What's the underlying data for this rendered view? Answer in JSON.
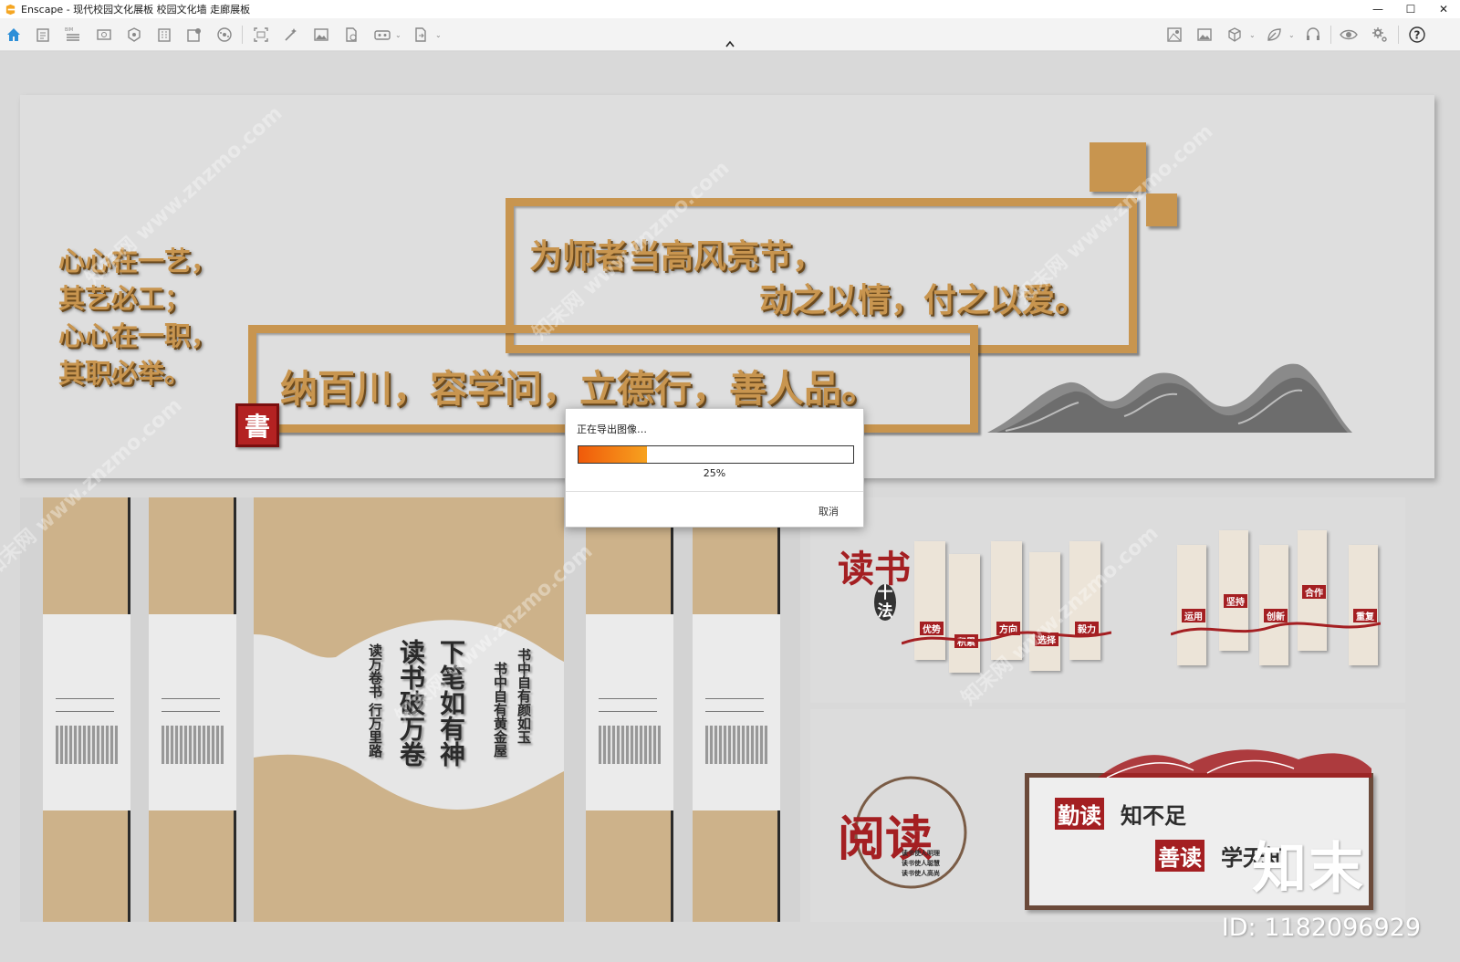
{
  "window": {
    "title": "Enscape - 现代校园文化展板 校园文化墙 走廊展板",
    "controls": {
      "minimize": "—",
      "maximize": "☐",
      "close": "✕"
    }
  },
  "toolbar": {
    "left_icons": [
      "home-icon",
      "project-icon",
      "bim-icon",
      "views-icon",
      "asset-icon",
      "building-icon",
      "material-icon",
      "atmosphere-icon",
      "screenshot-icon",
      "batch-icon",
      "image-icon",
      "document-icon",
      "vr-icon",
      "export-icon"
    ],
    "right_icons": [
      "visual-settings-icon",
      "gallery-icon",
      "cube-icon",
      "leaf-icon",
      "headset-icon",
      "eye-icon",
      "gear-icon",
      "help-icon"
    ],
    "bim_label": "BIM",
    "caret": "⌄",
    "collapse": "⌃",
    "help": "?"
  },
  "scene": {
    "top_panel": {
      "side_poem": [
        "心心在一艺，",
        "其艺必工；",
        "心心在一职，",
        "其职必举。"
      ],
      "motto_line1": "为师者当高风亮节，",
      "motto_line2": "动之以情，付之以爱。",
      "motto_line3": "纳百川，容学问，立德行，善人品。",
      "seal": "書"
    },
    "bottom_left": {
      "calligraphy_main": [
        "下笔如有神",
        "读书破万卷"
      ],
      "calligraphy_side": [
        "书中自有颜如玉",
        "书中自有黄金屋",
        "读万卷书",
        "行万里路"
      ]
    },
    "reading_methods": {
      "title_big": "读书",
      "title_sub": "十法",
      "labels": [
        "优势",
        "积累",
        "方向",
        "选择",
        "毅力",
        "运用",
        "坚持",
        "创新",
        "合作",
        "重复"
      ]
    },
    "reading_panel": {
      "circle_title": "阅读",
      "circle_lines": [
        "读书使人明理",
        "读书使人聪慧",
        "读书使人高尚"
      ],
      "label1": "勤读",
      "phrase1": "知不足",
      "label2": "善读",
      "phrase2": "学无知"
    }
  },
  "watermark": {
    "text": "知末网 www.znzmo.com",
    "brand": "知末",
    "id": "ID: 1182096929"
  },
  "export_dialog": {
    "title": "正在导出图像…",
    "progress_percent": 25,
    "progress_label": "25%",
    "cancel_label": "取消",
    "colors": {
      "bar_start": "#f05a0a",
      "bar_end": "#f7a21f"
    }
  },
  "colors": {
    "gold": "#c8954f",
    "red": "#a41f22",
    "wood": "#cdb28a"
  }
}
